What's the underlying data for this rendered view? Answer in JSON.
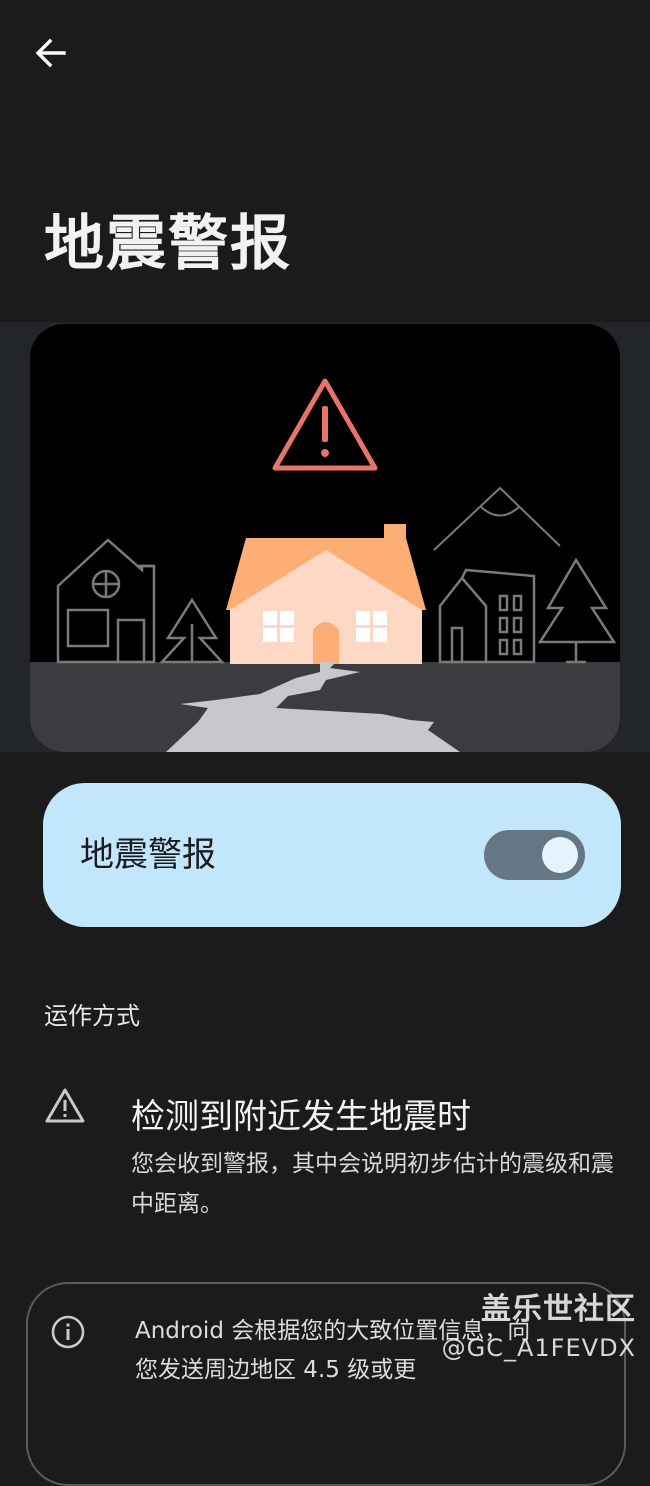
{
  "header": {
    "back_icon": "arrow-left-icon",
    "title": "地震警报"
  },
  "illustration": {
    "alert_icon": "warning-triangle-icon",
    "colors": {
      "background": "#000000",
      "ground": "#3a3c40",
      "crack": "#c6c8cb",
      "alert": "#e8736a",
      "roof": "#fdae74",
      "house_wall": "#fdd9c5",
      "outline": "#7a7a7a"
    }
  },
  "toggle": {
    "label": "地震警报",
    "enabled": true,
    "card_color": "#c2e6fb",
    "track_color": "#657784"
  },
  "section": {
    "header": "运作方式"
  },
  "detect_item": {
    "icon": "warning-triangle-icon",
    "title": "检测到附近发生地震时",
    "description": "您会收到警报，其中会说明初步估计的震级和震中距离。"
  },
  "info_card": {
    "icon": "info-circle-icon",
    "text": "Android 会根据您的大致位置信息，向您发送周边地区 4.5 级或更"
  },
  "watermark": {
    "title": "盖乐世社区",
    "handle": "@GC_A1FEVDX"
  }
}
